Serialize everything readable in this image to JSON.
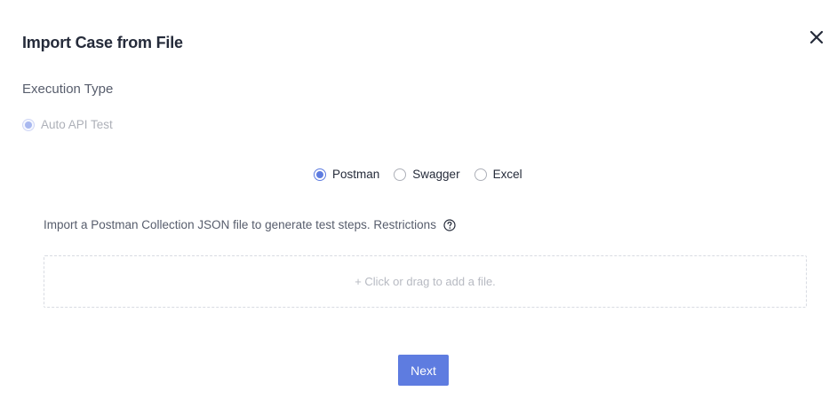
{
  "dialog": {
    "title": "Import Case from File",
    "close_icon": "close-icon"
  },
  "execution_type": {
    "label": "Execution Type",
    "options": [
      {
        "label": "Auto API Test",
        "selected": true,
        "disabled": true
      }
    ]
  },
  "source_type": {
    "options": [
      {
        "label": "Postman",
        "selected": true
      },
      {
        "label": "Swagger",
        "selected": false
      },
      {
        "label": "Excel",
        "selected": false
      }
    ]
  },
  "hint": {
    "text": "Import a Postman Collection JSON file to generate test steps. Restrictions",
    "icon": "help-circle-icon"
  },
  "upload": {
    "text": "+ Click or drag to add a file."
  },
  "footer": {
    "next_label": "Next"
  },
  "colors": {
    "accent": "#5e7ce0",
    "text_primary": "#252b3a",
    "text_secondary": "#575d6c",
    "text_disabled": "#adb0b8"
  }
}
